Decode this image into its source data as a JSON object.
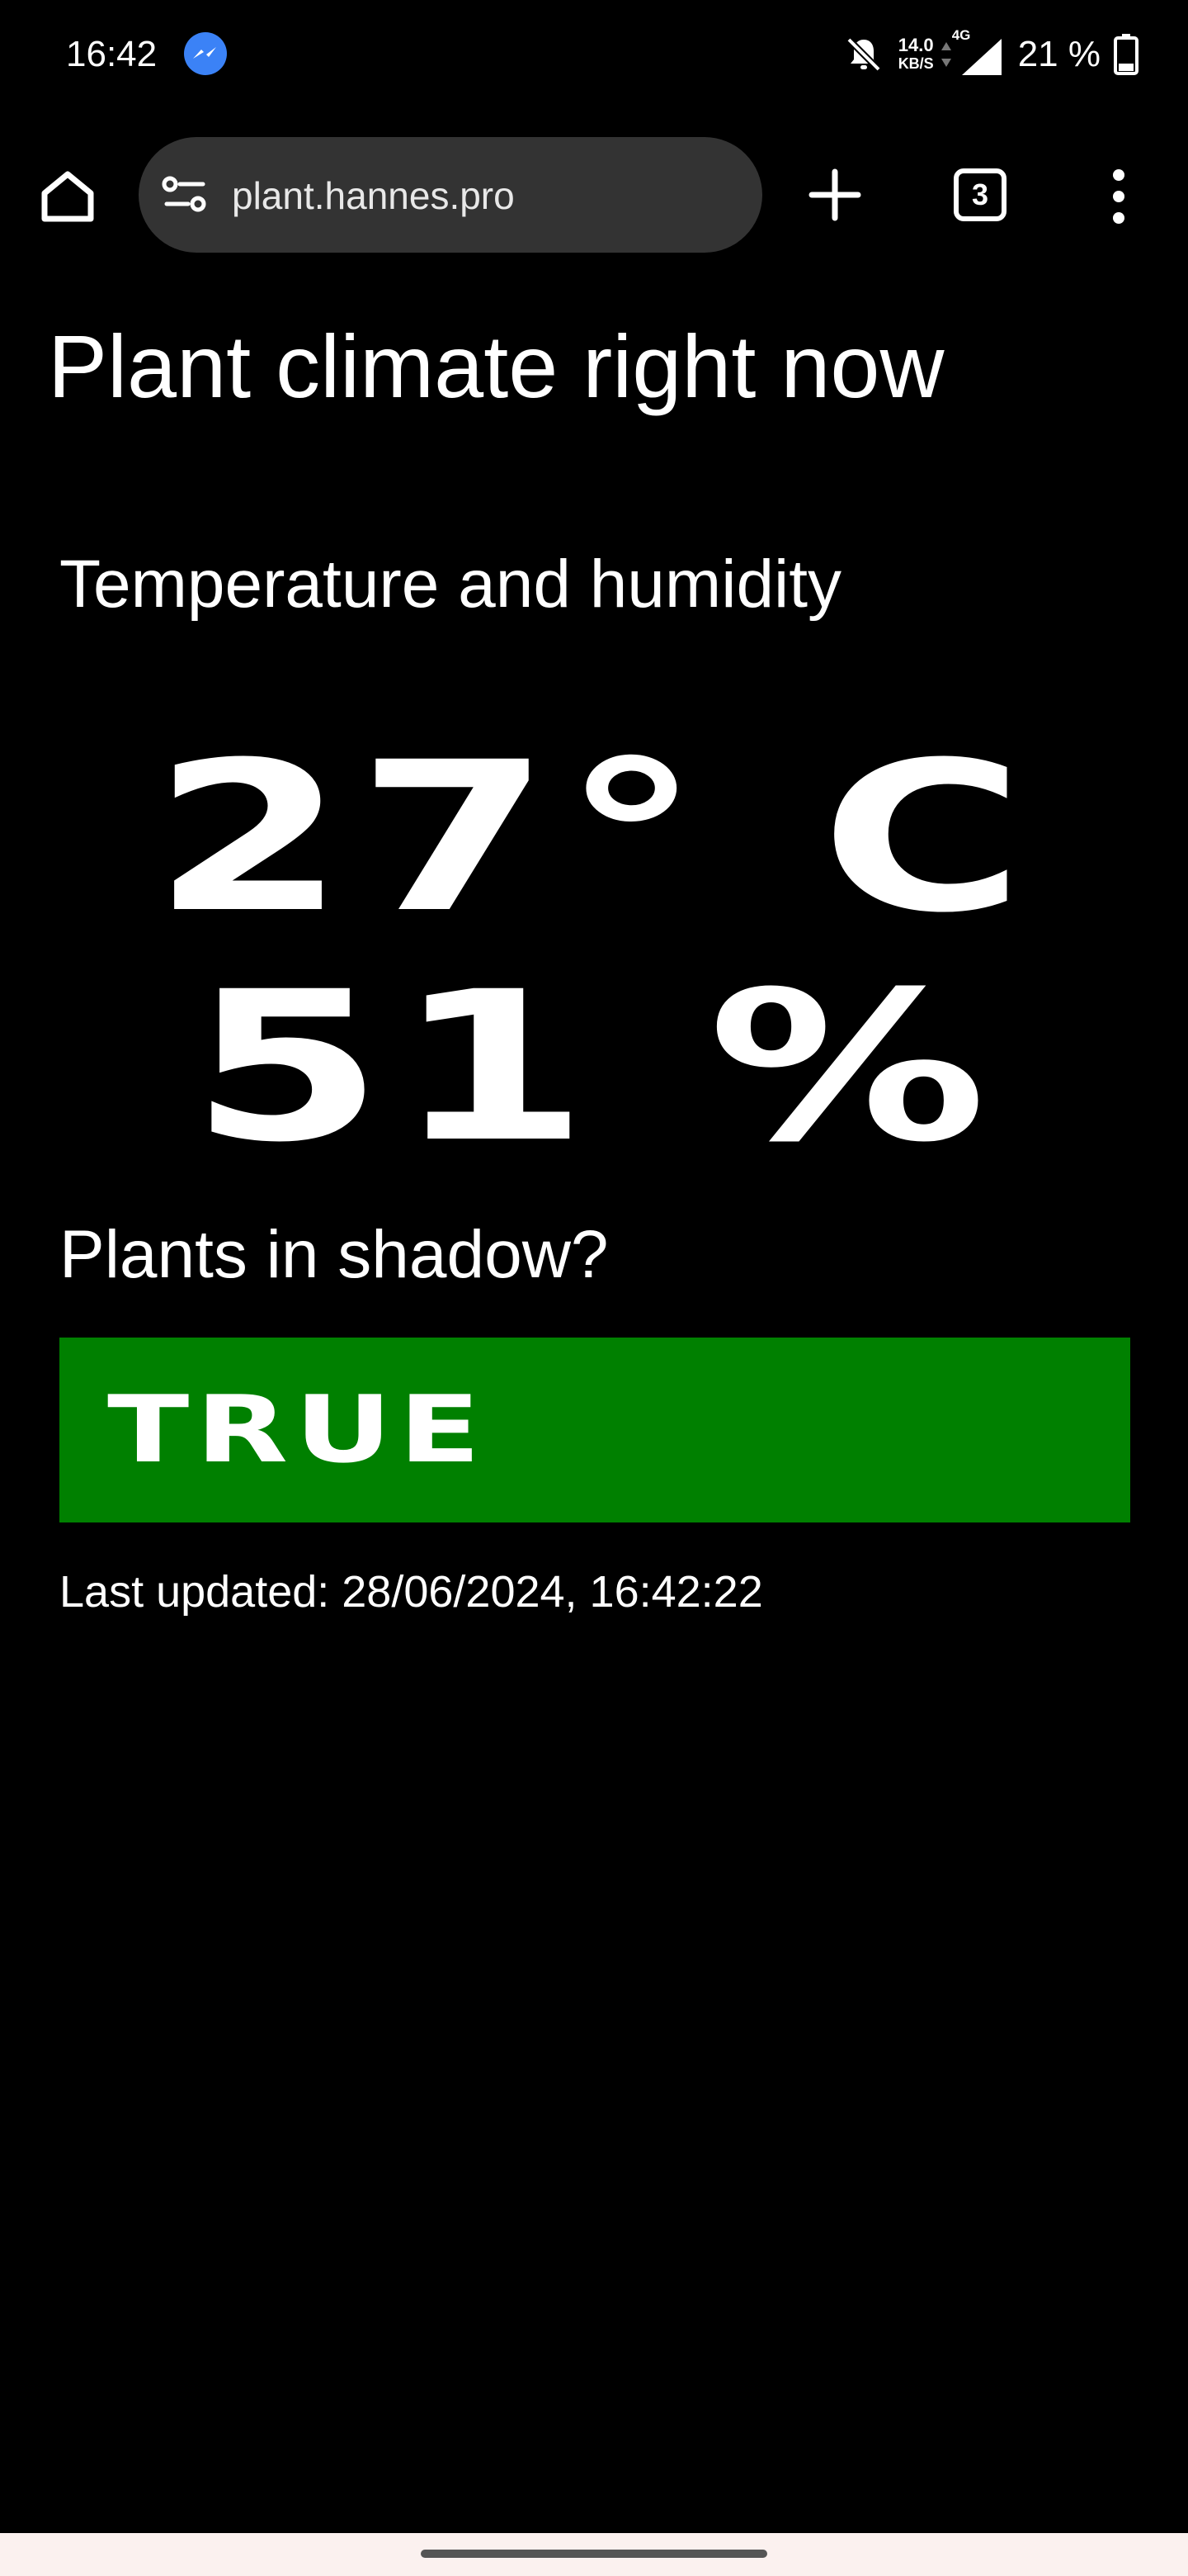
{
  "status_bar": {
    "time": "16:42",
    "net_speed_value": "14.0",
    "net_speed_unit": "KB/S",
    "network_type": "4G",
    "battery": "21 %",
    "icons": [
      "messenger-icon",
      "bell-off-icon",
      "data-arrows-icon",
      "signal-icon",
      "battery-icon"
    ]
  },
  "browser": {
    "url": "plant.hannes.pro",
    "tab_count": "3",
    "icons": [
      "home-icon",
      "site-settings-icon",
      "plus-icon",
      "more-vert-icon"
    ]
  },
  "page": {
    "title": "Plant climate right now",
    "temp_humidity_heading": "Temperature and humidity",
    "temperature": "27° C",
    "humidity": "51 %",
    "shadow_heading": "Plants in shadow?",
    "shadow_value": "TRUE",
    "shadow_color": "#008000",
    "last_updated": "Last updated: 28/06/2024, 16:42:22"
  }
}
